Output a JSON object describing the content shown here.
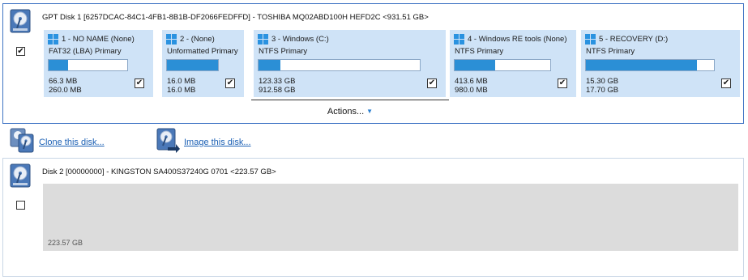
{
  "disk1": {
    "title": "GPT Disk 1 [6257DCAC-84C1-4FB1-8B1B-DF2066FEDFFD] - TOSHIBA MQ02ABD100H HEFD2C  <931.51 GB>",
    "checked": true,
    "icon": "hard-disk-icon",
    "partitions": [
      {
        "label": "1 - NO NAME (None)",
        "fs": "FAT32 (LBA) Primary",
        "used": "66.3 MB",
        "total": "260.0 MB",
        "fill": 0.25,
        "checked": true
      },
      {
        "label": "2 -  (None)",
        "fs": "Unformatted Primary",
        "used": "16.0 MB",
        "total": "16.0 MB",
        "fill": 1.0,
        "checked": true
      },
      {
        "label": "3 - Windows (C:)",
        "fs": "NTFS Primary",
        "used": "123.33 GB",
        "total": "912.58 GB",
        "fill": 0.135,
        "checked": true
      },
      {
        "label": "4 - Windows RE tools (None)",
        "fs": "NTFS Primary",
        "used": "413.6 MB",
        "total": "980.0 MB",
        "fill": 0.42,
        "checked": true
      },
      {
        "label": "5 - RECOVERY (D:)",
        "fs": "NTFS Primary",
        "used": "15.30 GB",
        "total": "17.70 GB",
        "fill": 0.865,
        "checked": true
      }
    ],
    "actions_label": "Actions..."
  },
  "links": {
    "clone_label": "Clone this disk...",
    "image_label": "Image this disk..."
  },
  "disk2": {
    "title": "Disk 2 [00000000] - KINGSTON  SA400S37240G    0701  <223.57 GB>",
    "checked": false,
    "size_label": "223.57 GB"
  },
  "colors": {
    "accent": "#2b8fd6",
    "partition_bg": "#cfe3f7",
    "panel_border": "#3f74c4",
    "link": "#1a5fb4",
    "unallocated": "#dcdcdc"
  }
}
